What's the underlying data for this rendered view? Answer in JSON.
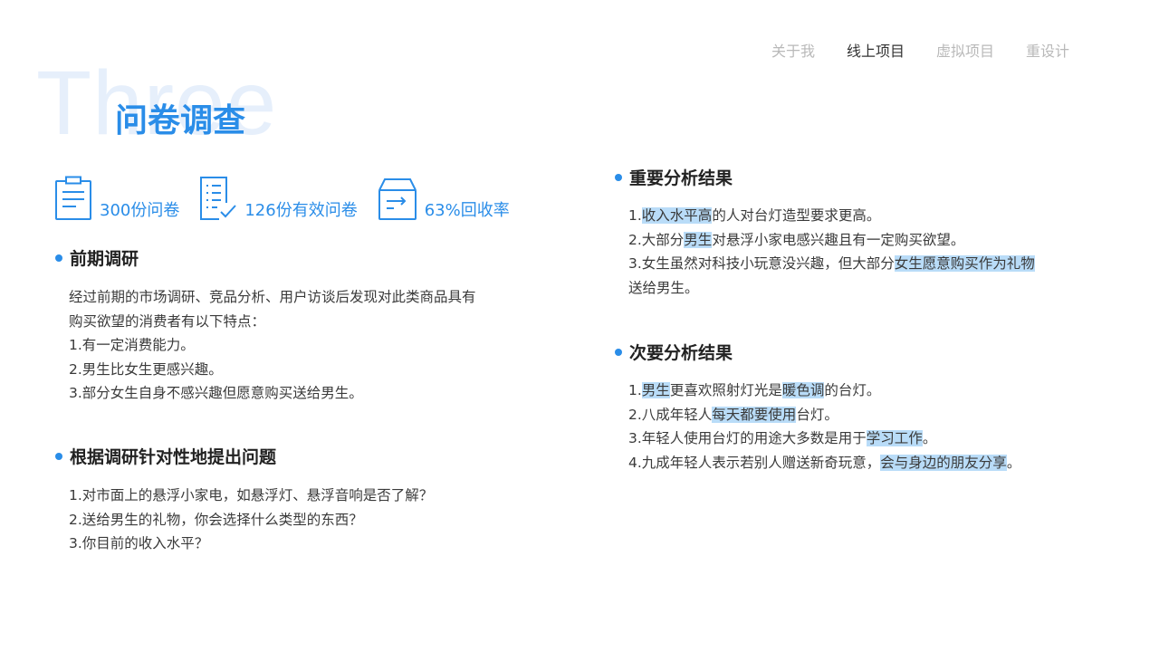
{
  "nav": {
    "items": [
      {
        "label": "关于我",
        "active": false
      },
      {
        "label": "线上项目",
        "active": true
      },
      {
        "label": "虚拟项目",
        "active": false
      },
      {
        "label": "重设计",
        "active": false
      }
    ]
  },
  "header": {
    "bg_word": "Three",
    "title": "问卷调查"
  },
  "stats": [
    {
      "icon": "clipboard-icon",
      "label": "300份问卷"
    },
    {
      "icon": "checklist-icon",
      "label": "126份有效问卷"
    },
    {
      "icon": "return-box-icon",
      "label": "63%回收率"
    }
  ],
  "research": {
    "heading": "前期调研",
    "lines": [
      "经过前期的市场调研、竞品分析、用户访谈后发现对此类商品具有",
      "购买欲望的消费者有以下特点：",
      "1.有一定消费能力。",
      "2.男生比女生更感兴趣。",
      "3.部分女生自身不感兴趣但愿意购买送给男生。"
    ]
  },
  "questions": {
    "heading": "根据调研针对性地提出问题",
    "lines": [
      "1.对市面上的悬浮小家电，如悬浮灯、悬浮音响是否了解？",
      "2.送给男生的礼物，你会选择什么类型的东西？",
      "3.你目前的收入水平？"
    ]
  },
  "primary_results": {
    "heading": "重要分析结果",
    "lines": [
      [
        {
          "t": "1."
        },
        {
          "t": "收入水平高",
          "hl": true
        },
        {
          "t": "的人对台灯造型要求更高。"
        }
      ],
      [
        {
          "t": "2.大部分"
        },
        {
          "t": "男生",
          "hl": true
        },
        {
          "t": "对悬浮小家电感兴趣且有一定购买欲望。"
        }
      ],
      [
        {
          "t": "3.女生虽然对科技小玩意没兴趣，但大部分"
        },
        {
          "t": "女生愿意购买作为礼物",
          "hl": true
        }
      ],
      [
        {
          "t": "送给男生。"
        }
      ]
    ]
  },
  "secondary_results": {
    "heading": "次要分析结果",
    "lines": [
      [
        {
          "t": "1."
        },
        {
          "t": "男生",
          "hl": true
        },
        {
          "t": "更喜欢照射灯光是"
        },
        {
          "t": "暖色调",
          "hl": true
        },
        {
          "t": "的台灯。"
        }
      ],
      [
        {
          "t": "2.八成年轻人"
        },
        {
          "t": "每天都要使用",
          "hl": true
        },
        {
          "t": "台灯。"
        }
      ],
      [
        {
          "t": "3.年轻人使用台灯的用途大多数是用于"
        },
        {
          "t": "学习工作",
          "hl": true
        },
        {
          "t": "。"
        }
      ],
      [
        {
          "t": "4.九成年轻人表示若别人赠送新奇玩意，"
        },
        {
          "t": "会与身边的朋友分享",
          "hl": true
        },
        {
          "t": "。"
        }
      ]
    ]
  },
  "colors": {
    "accent": "#2a8de8",
    "highlight": "#b9dcf8",
    "bg_word": "#e6effb",
    "nav_inactive": "#b9b9b9"
  }
}
